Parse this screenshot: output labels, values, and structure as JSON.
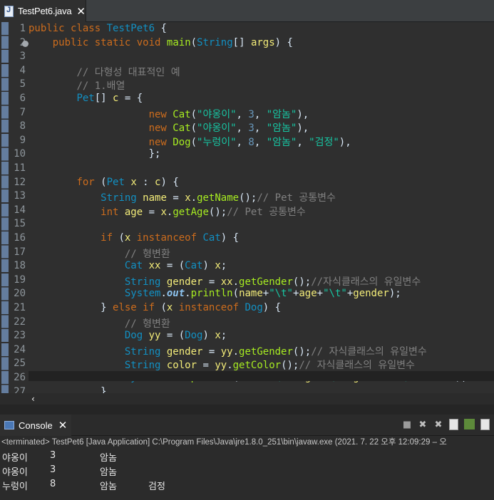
{
  "editor_tab": {
    "title": "TestPet6.java",
    "close": "✕"
  },
  "code_lines": [
    {
      "n": "1",
      "tokens": [
        [
          "kw",
          "public "
        ],
        [
          "kw",
          "class "
        ],
        [
          "ty",
          "TestPet6"
        ],
        [
          "",
          " {"
        ]
      ]
    },
    {
      "n": "2",
      "tokens": [
        [
          "",
          "    "
        ],
        [
          "kw",
          "public "
        ],
        [
          "kw",
          "static "
        ],
        [
          "kw",
          "void "
        ],
        [
          "fn",
          "main"
        ],
        [
          "",
          "("
        ],
        [
          "ty",
          "String"
        ],
        [
          "",
          "[] "
        ],
        [
          "vr",
          "args"
        ],
        [
          "",
          ") {"
        ]
      ]
    },
    {
      "n": "3",
      "tokens": []
    },
    {
      "n": "4",
      "tokens": [
        [
          "",
          "        "
        ],
        [
          "cm",
          "// 다형성 대표적인 예"
        ]
      ]
    },
    {
      "n": "5",
      "tokens": [
        [
          "",
          "        "
        ],
        [
          "cm",
          "// 1.배열"
        ]
      ]
    },
    {
      "n": "6",
      "tokens": [
        [
          "",
          "        "
        ],
        [
          "ty",
          "Pet"
        ],
        [
          "",
          "[] "
        ],
        [
          "vr",
          "c"
        ],
        [
          "",
          " = {"
        ]
      ]
    },
    {
      "n": "7",
      "tokens": [
        [
          "",
          "                    "
        ],
        [
          "kw",
          "new "
        ],
        [
          "fn",
          "Cat"
        ],
        [
          "",
          "("
        ],
        [
          "str",
          "\"야옹이\""
        ],
        [
          "",
          ", "
        ],
        [
          "num",
          "3"
        ],
        [
          "",
          ", "
        ],
        [
          "str",
          "\"암놈\""
        ],
        [
          "",
          "),"
        ]
      ]
    },
    {
      "n": "8",
      "tokens": [
        [
          "",
          "                    "
        ],
        [
          "kw",
          "new "
        ],
        [
          "fn",
          "Cat"
        ],
        [
          "",
          "("
        ],
        [
          "str",
          "\"야옹이\""
        ],
        [
          "",
          ", "
        ],
        [
          "num",
          "3"
        ],
        [
          "",
          ", "
        ],
        [
          "str",
          "\"암놈\""
        ],
        [
          "",
          "),"
        ]
      ]
    },
    {
      "n": "9",
      "tokens": [
        [
          "",
          "                    "
        ],
        [
          "kw",
          "new "
        ],
        [
          "fn",
          "Dog"
        ],
        [
          "",
          "("
        ],
        [
          "str",
          "\"누렁이\""
        ],
        [
          "",
          ", "
        ],
        [
          "num",
          "8"
        ],
        [
          "",
          ", "
        ],
        [
          "str",
          "\"암놈\""
        ],
        [
          "",
          ", "
        ],
        [
          "str",
          "\"검정\""
        ],
        [
          "",
          "),"
        ]
      ]
    },
    {
      "n": "10",
      "tokens": [
        [
          "",
          "                    };"
        ]
      ]
    },
    {
      "n": "11",
      "tokens": []
    },
    {
      "n": "12",
      "tokens": [
        [
          "",
          "        "
        ],
        [
          "kw",
          "for "
        ],
        [
          "",
          "("
        ],
        [
          "ty",
          "Pet "
        ],
        [
          "vr",
          "x"
        ],
        [
          "",
          " : "
        ],
        [
          "vr",
          "c"
        ],
        [
          "",
          ") {"
        ]
      ]
    },
    {
      "n": "13",
      "tokens": [
        [
          "",
          "            "
        ],
        [
          "ty",
          "String "
        ],
        [
          "vr",
          "name"
        ],
        [
          "",
          " = "
        ],
        [
          "vr",
          "x"
        ],
        [
          "",
          "."
        ],
        [
          "fn",
          "getName"
        ],
        [
          "",
          "();"
        ],
        [
          "cm",
          "// Pet 공통변수"
        ]
      ]
    },
    {
      "n": "14",
      "tokens": [
        [
          "",
          "            "
        ],
        [
          "kw",
          "int "
        ],
        [
          "vr",
          "age"
        ],
        [
          "",
          " = "
        ],
        [
          "vr",
          "x"
        ],
        [
          "",
          "."
        ],
        [
          "fn",
          "getAge"
        ],
        [
          "",
          "();"
        ],
        [
          "cm",
          "// Pet 공통변수"
        ]
      ]
    },
    {
      "n": "15",
      "tokens": []
    },
    {
      "n": "16",
      "tokens": [
        [
          "",
          "            "
        ],
        [
          "kw",
          "if "
        ],
        [
          "",
          "("
        ],
        [
          "vr",
          "x "
        ],
        [
          "kw",
          "instanceof "
        ],
        [
          "ty",
          "Cat"
        ],
        [
          "",
          ") {"
        ]
      ]
    },
    {
      "n": "17",
      "tokens": [
        [
          "",
          "                "
        ],
        [
          "cm",
          "// 형변환"
        ]
      ]
    },
    {
      "n": "18",
      "tokens": [
        [
          "",
          "                "
        ],
        [
          "ty",
          "Cat "
        ],
        [
          "vr",
          "xx"
        ],
        [
          "",
          " = ("
        ],
        [
          "ty",
          "Cat"
        ],
        [
          "",
          ") "
        ],
        [
          "vr",
          "x"
        ],
        [
          "",
          ";"
        ]
      ]
    },
    {
      "n": "19",
      "tokens": [
        [
          "",
          "                "
        ],
        [
          "ty",
          "String "
        ],
        [
          "vr",
          "gender"
        ],
        [
          "",
          " = "
        ],
        [
          "vr",
          "xx"
        ],
        [
          "",
          "."
        ],
        [
          "fn",
          "getGender"
        ],
        [
          "",
          "();"
        ],
        [
          "cm",
          "//자식클래스의 유일변수"
        ]
      ]
    },
    {
      "n": "20",
      "tokens": [
        [
          "",
          "                "
        ],
        [
          "ty",
          "System"
        ],
        [
          "",
          "."
        ],
        [
          "fld",
          "out"
        ],
        [
          "",
          "."
        ],
        [
          "fn",
          "println"
        ],
        [
          "",
          "("
        ],
        [
          "vr",
          "name"
        ],
        [
          "",
          "+"
        ],
        [
          "str",
          "\"\\t\""
        ],
        [
          "",
          "+"
        ],
        [
          "vr",
          "age"
        ],
        [
          "",
          "+"
        ],
        [
          "str",
          "\"\\t\""
        ],
        [
          "",
          "+"
        ],
        [
          "vr",
          "gender"
        ],
        [
          "",
          ");"
        ]
      ]
    },
    {
      "n": "21",
      "tokens": [
        [
          "",
          "            } "
        ],
        [
          "kw",
          "else "
        ],
        [
          "kw",
          "if "
        ],
        [
          "",
          "("
        ],
        [
          "vr",
          "x "
        ],
        [
          "kw",
          "instanceof "
        ],
        [
          "ty",
          "Dog"
        ],
        [
          "",
          ") {"
        ]
      ]
    },
    {
      "n": "22",
      "tokens": [
        [
          "",
          "                "
        ],
        [
          "cm",
          "// 형변환"
        ]
      ]
    },
    {
      "n": "23",
      "tokens": [
        [
          "",
          "                "
        ],
        [
          "ty",
          "Dog "
        ],
        [
          "vr",
          "yy"
        ],
        [
          "",
          " = ("
        ],
        [
          "ty",
          "Dog"
        ],
        [
          "",
          ") "
        ],
        [
          "vr",
          "x"
        ],
        [
          "",
          ";"
        ]
      ]
    },
    {
      "n": "24",
      "tokens": [
        [
          "",
          "                "
        ],
        [
          "ty",
          "String "
        ],
        [
          "vr",
          "gender"
        ],
        [
          "",
          " = "
        ],
        [
          "vr",
          "yy"
        ],
        [
          "",
          "."
        ],
        [
          "fn",
          "getGender"
        ],
        [
          "",
          "();"
        ],
        [
          "cm",
          "// 자식클래스의 유일변수"
        ]
      ]
    },
    {
      "n": "25",
      "tokens": [
        [
          "",
          "                "
        ],
        [
          "ty",
          "String "
        ],
        [
          "vr",
          "color"
        ],
        [
          "",
          " = "
        ],
        [
          "vr",
          "yy"
        ],
        [
          "",
          "."
        ],
        [
          "fn",
          "getColor"
        ],
        [
          "",
          "();"
        ],
        [
          "cm",
          "// 자식클래스의 유일변수"
        ]
      ]
    },
    {
      "n": "26",
      "tokens": [
        [
          "",
          "                "
        ],
        [
          "ty",
          "System"
        ],
        [
          "",
          "."
        ],
        [
          "fld",
          "out"
        ],
        [
          "",
          "."
        ],
        [
          "fn",
          "println"
        ],
        [
          "",
          "("
        ],
        [
          "vr",
          "name"
        ],
        [
          "",
          "+"
        ],
        [
          "str",
          "\"\\t\""
        ],
        [
          "",
          "+"
        ],
        [
          "vr",
          "age"
        ],
        [
          "",
          "+"
        ],
        [
          "str",
          "\"\\t\""
        ],
        [
          "",
          "+"
        ],
        [
          "vr",
          "gender"
        ],
        [
          "",
          "+"
        ],
        [
          "str",
          "\"\\t\""
        ],
        [
          "",
          "+"
        ],
        [
          "vr",
          "color"
        ],
        [
          "",
          ");"
        ]
      ]
    },
    {
      "n": "27",
      "tokens": [
        [
          "",
          "            }"
        ]
      ]
    }
  ],
  "console": {
    "tab_label": "Console",
    "close": "✕",
    "status": "<terminated> TestPet6 [Java Application] C:\\Program Files\\Java\\jre1.8.0_251\\bin\\javaw.exe  (2021. 7. 22 오후 12:09:29 – 오",
    "rows": [
      [
        "야옹이",
        "3",
        "암놈",
        ""
      ],
      [
        "야옹이",
        "3",
        "암놈",
        ""
      ],
      [
        "누렁이",
        "8",
        "암놈",
        "검정"
      ]
    ]
  },
  "toolbar_icons": [
    "terminate-icon",
    "remove-launch-icon",
    "remove-all-icon",
    "scroll-lock-icon",
    "pin-console-icon",
    "display-console-icon"
  ],
  "colors": {
    "keyword": "#cc6c1d",
    "type": "#1290c3",
    "string": "#17c6a3",
    "comment": "#808080",
    "variable": "#f3ec79",
    "method": "#a7ec21",
    "background": "#2f2f2f"
  }
}
